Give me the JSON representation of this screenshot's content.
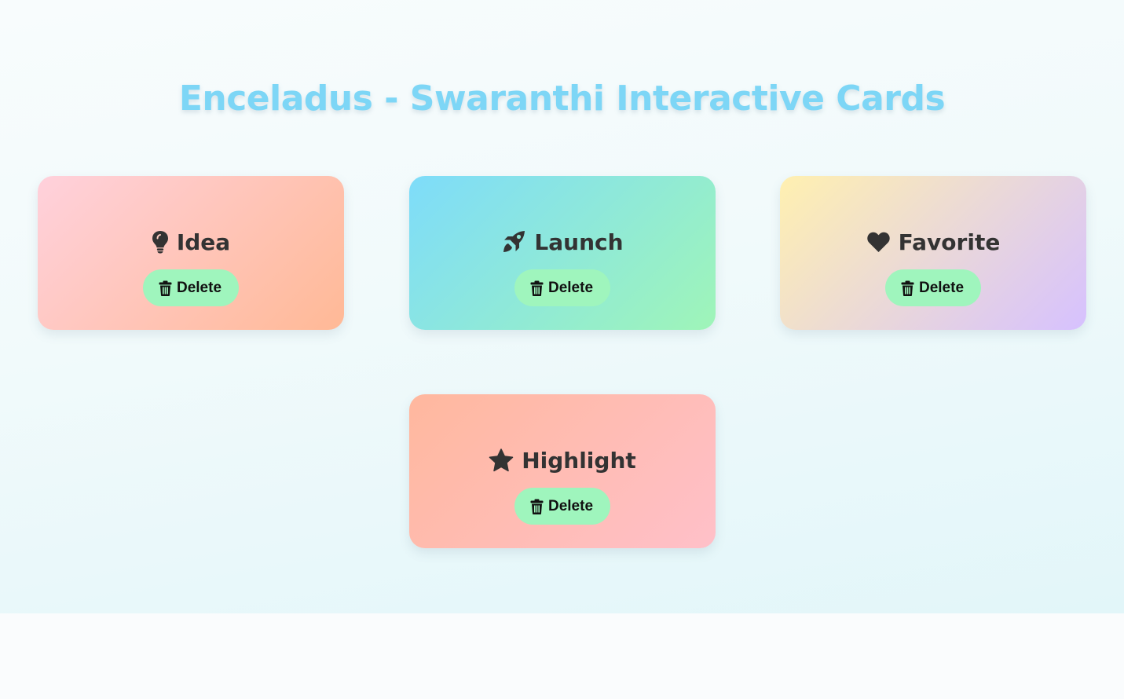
{
  "page": {
    "title": "Enceladus - Swaranthi Interactive Cards"
  },
  "cards": [
    {
      "title": "Idea",
      "icon": "lightbulb-icon",
      "button_label": "Delete",
      "button_icon": "trash-icon",
      "gradient": [
        "#ffd1dc",
        "#ffb996"
      ]
    },
    {
      "title": "Launch",
      "icon": "rocket-icon",
      "button_label": "Delete",
      "button_icon": "trash-icon",
      "gradient": [
        "#7edcfa",
        "#9ff5b8"
      ]
    },
    {
      "title": "Favorite",
      "icon": "heart-icon",
      "button_label": "Delete",
      "button_icon": "trash-icon",
      "gradient": [
        "#fff0b0",
        "#d6c1ff"
      ]
    },
    {
      "title": "Highlight",
      "icon": "star-icon",
      "button_label": "Delete",
      "button_icon": "trash-icon",
      "gradient": [
        "#ffb89e",
        "#ffc0c9"
      ]
    }
  ],
  "colors": {
    "title": "#7dd6f6",
    "button": "#9ff5bd",
    "card_text": "#333333"
  }
}
